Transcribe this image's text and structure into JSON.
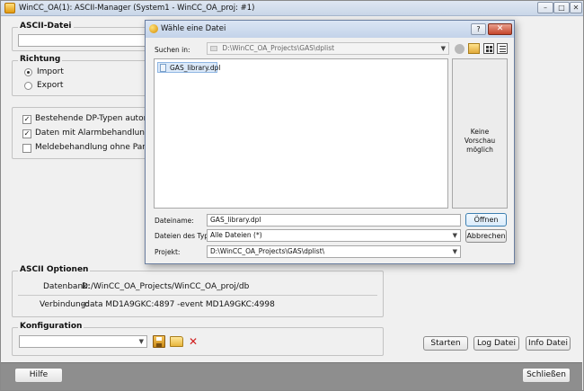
{
  "main": {
    "title": "WinCC_OA(1): ASCII-Manager (System1 - WinCC_OA_proj: #1)",
    "window_controls": {
      "minimize": "–",
      "maximize": "□",
      "close": "✕"
    },
    "ascii_file": {
      "group_title": "ASCII-Datei",
      "value": ""
    },
    "direction": {
      "group_title": "Richtung",
      "options": [
        {
          "label": "Import",
          "selected": true
        },
        {
          "label": "Export",
          "selected": false
        }
      ]
    },
    "options": [
      {
        "label": "Bestehende DP-Typen autom. ände",
        "checked": true
      },
      {
        "label": "Daten mit Alarmbehandlung einspie",
        "checked": true
      },
      {
        "label": "Meldebehandlung ohne Parametrier",
        "checked": false
      }
    ],
    "ascii_options": {
      "group_title": "ASCII Optionen",
      "rows": [
        {
          "label": "Datenbank:",
          "value": "D:/WinCC_OA_Projects/WinCC_OA_proj/db"
        },
        {
          "label": "Verbindung:",
          "value": "-data MD1A9GKC:4897 -event MD1A9GKC:4998"
        }
      ]
    },
    "configuration": {
      "group_title": "Konfiguration",
      "value": ""
    },
    "actions": {
      "start": "Starten",
      "log": "Log Datei",
      "info": "Info Datei"
    },
    "footer": {
      "help": "Hilfe",
      "close": "Schließen"
    }
  },
  "dialog": {
    "title": "Wähle eine Datei",
    "help_button": "?",
    "close_button": "✕",
    "look_in": {
      "label": "Suchen in:",
      "path": "D:\\WinCC_OA_Projects\\GAS\\dplist"
    },
    "files": [
      {
        "name": "GAS_library.dpl",
        "selected": true
      }
    ],
    "preview_text": "Keine Vorschau möglich",
    "filename": {
      "label": "Dateiname:",
      "value": "GAS_library.dpl"
    },
    "filetype": {
      "label": "Dateien des Typs:",
      "value": "Alle Dateien (*)"
    },
    "project": {
      "label": "Projekt:",
      "value": "D:\\WinCC_OA_Projects\\GAS\\dplist\\"
    },
    "open_button": "Öffnen",
    "cancel_button": "Abbrechen"
  }
}
